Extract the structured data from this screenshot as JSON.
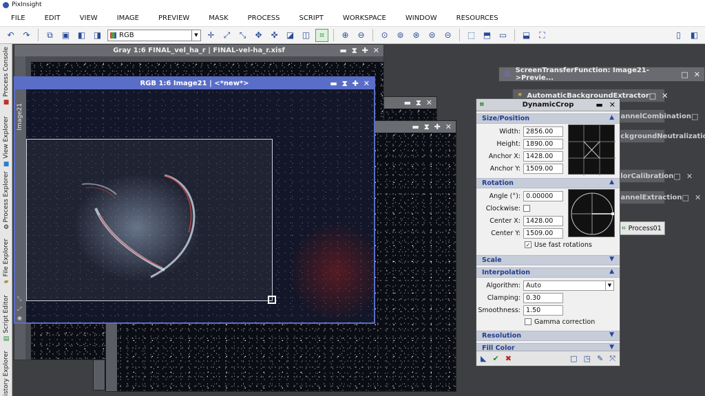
{
  "app": {
    "title": "PixInsight"
  },
  "menu": [
    "FILE",
    "EDIT",
    "VIEW",
    "IMAGE",
    "PREVIEW",
    "MASK",
    "PROCESS",
    "SCRIPT",
    "WORKSPACE",
    "WINDOW",
    "RESOURCES"
  ],
  "toolbar": {
    "channel_select": "RGB"
  },
  "left_dock": [
    "Process Console",
    "View Explorer",
    "Process Explorer",
    "File Explorer",
    "Script Editor",
    "History Explorer"
  ],
  "windows": {
    "gray": {
      "title": "Gray 1:6 FINAL_vel_ha_r | FINAL-vel-ha_r.xisf"
    },
    "rgb": {
      "title": "RGB 1:6 Image21 | <*new*>",
      "side_tab": "Image21"
    }
  },
  "icons_panel": [
    {
      "label": "ScreenTransferFunction: Image21->Previe..."
    },
    {
      "label": "AutomaticBackgroundExtractor"
    },
    {
      "label": "ChannelCombination"
    },
    {
      "label": "BackgroundNeutralization"
    },
    {
      "label": "ColorCalibration"
    },
    {
      "label": "ChannelExtraction"
    }
  ],
  "dynamic_crop": {
    "title": "DynamicCrop",
    "sections": {
      "size_position": "Size/Position",
      "rotation": "Rotation",
      "scale": "Scale",
      "interpolation": "Interpolation",
      "resolution": "Resolution",
      "fill_color": "Fill Color"
    },
    "size_position": {
      "width_label": "Width:",
      "width": "2856.00",
      "height_label": "Height:",
      "height": "1890.00",
      "anchor_x_label": "Anchor X:",
      "anchor_x": "1428.00",
      "anchor_y_label": "Anchor Y:",
      "anchor_y": "1509.00"
    },
    "rotation": {
      "angle_label": "Angle (°):",
      "angle": "0.00000",
      "clockwise_label": "Clockwise:",
      "clockwise": false,
      "center_x_label": "Center X:",
      "center_x": "1428.00",
      "center_y_label": "Center Y:",
      "center_y": "1509.00",
      "fast_rotations_label": "Use fast rotations",
      "fast_rotations": true
    },
    "interpolation": {
      "algorithm_label": "Algorithm:",
      "algorithm": "Auto",
      "clamping_label": "Clamping:",
      "clamping": "0.30",
      "smoothness_label": "Smoothness:",
      "smoothness": "1.50",
      "gamma_label": "Gamma correction",
      "gamma": false
    }
  },
  "process_icon": {
    "label": "Process01"
  },
  "colors": {
    "active_title": "#5a6ec8",
    "section_text": "#23408f",
    "apply_green": "#1a8a1a",
    "cancel_red": "#c02020"
  }
}
